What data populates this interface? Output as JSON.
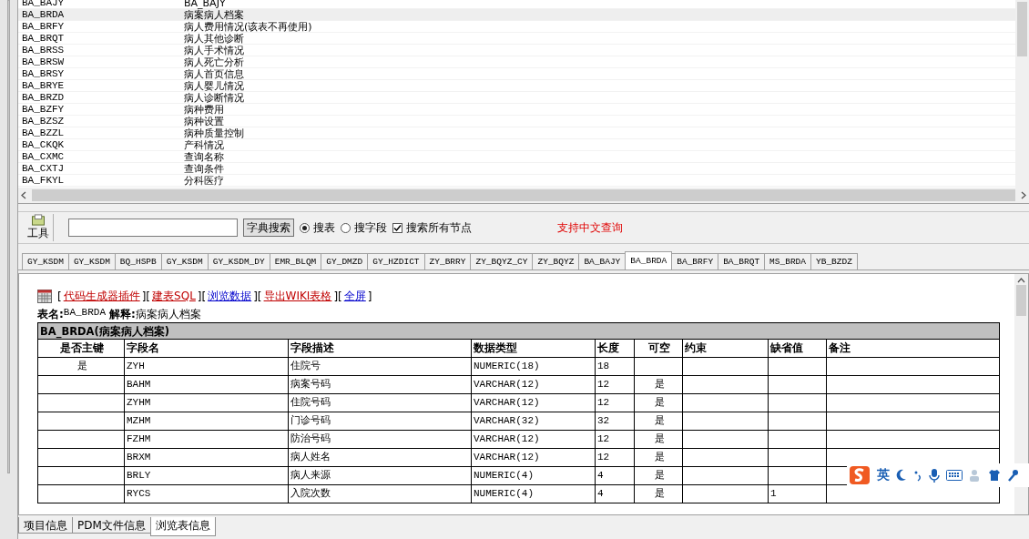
{
  "table_list": {
    "rows": [
      {
        "code": "BA_BAJY",
        "name": "BA_BAJY",
        "selected": false
      },
      {
        "code": "BA_BRDA",
        "name": "病案病人档案",
        "selected": true
      },
      {
        "code": "BA_BRFY",
        "name": "病人费用情况(该表不再使用)",
        "selected": false
      },
      {
        "code": "BA_BRQT",
        "name": "病人其他诊断",
        "selected": false
      },
      {
        "code": "BA_BRSS",
        "name": "病人手术情况",
        "selected": false
      },
      {
        "code": "BA_BRSW",
        "name": "病人死亡分析",
        "selected": false
      },
      {
        "code": "BA_BRSY",
        "name": "病人首页信息",
        "selected": false
      },
      {
        "code": "BA_BRYE",
        "name": "病人婴儿情况",
        "selected": false
      },
      {
        "code": "BA_BRZD",
        "name": "病人诊断情况",
        "selected": false
      },
      {
        "code": "BA_BZFY",
        "name": "病种费用",
        "selected": false
      },
      {
        "code": "BA_BZSZ",
        "name": "病种设置",
        "selected": false
      },
      {
        "code": "BA_BZZL",
        "name": "病种质量控制",
        "selected": false
      },
      {
        "code": "BA_CKQK",
        "name": "产科情况",
        "selected": false
      },
      {
        "code": "BA_CXMC",
        "name": "查询名称",
        "selected": false
      },
      {
        "code": "BA_CXTJ",
        "name": "查询条件",
        "selected": false
      },
      {
        "code": "BA_FKYL",
        "name": "分科医疗",
        "selected": false
      }
    ]
  },
  "toolbar": {
    "tool_button": "工具",
    "search_button": "字典搜索",
    "search_modes": [
      {
        "label": "搜表",
        "selected": true
      },
      {
        "label": "搜字段",
        "selected": false
      }
    ],
    "all_nodes": {
      "label": "搜索所有节点",
      "checked": true
    },
    "hint": "支持中文查询"
  },
  "table_tabs": [
    {
      "label": "GY_KSDM",
      "selected": false
    },
    {
      "label": "GY_KSDM",
      "selected": false
    },
    {
      "label": "BQ_HSPB",
      "selected": false
    },
    {
      "label": "GY_KSDM",
      "selected": false
    },
    {
      "label": "GY_KSDM_DY",
      "selected": false
    },
    {
      "label": "EMR_BLQM",
      "selected": false
    },
    {
      "label": "GY_DMZD",
      "selected": false
    },
    {
      "label": "GY_HZDICT",
      "selected": false
    },
    {
      "label": "ZY_BRRY",
      "selected": false
    },
    {
      "label": "ZY_BQYZ_CY",
      "selected": false
    },
    {
      "label": "ZY_BQYZ",
      "selected": false
    },
    {
      "label": "BA_BAJY",
      "selected": false
    },
    {
      "label": "BA_BRDA",
      "selected": true
    },
    {
      "label": "BA_BRFY",
      "selected": false
    },
    {
      "label": "BA_BRQT",
      "selected": false
    },
    {
      "label": "MS_BRDA",
      "selected": false
    },
    {
      "label": "YB_BZDZ",
      "selected": false
    }
  ],
  "detail": {
    "link_bar": [
      {
        "kind": "punct",
        "text": "["
      },
      {
        "kind": "link",
        "text": "代码生成器插件",
        "color": "#c00000"
      },
      {
        "kind": "punct",
        "text": "]["
      },
      {
        "kind": "link",
        "text": "建表SQL",
        "color": "#c00000"
      },
      {
        "kind": "punct",
        "text": "]["
      },
      {
        "kind": "link",
        "text": "浏览数据",
        "color": "#0000cc"
      },
      {
        "kind": "punct",
        "text": "]["
      },
      {
        "kind": "link",
        "text": "导出WIKI表格",
        "color": "#c00000"
      },
      {
        "kind": "punct",
        "text": "]["
      },
      {
        "kind": "link",
        "text": "全屏",
        "color": "#0000cc"
      },
      {
        "kind": "punct",
        "text": "]"
      }
    ],
    "table_name_label": "表名:",
    "table_name": "BA_BRDA",
    "comment_label": "解释:",
    "comment": "病案病人档案",
    "grid_title": "BA_BRDA(病案病人档案)",
    "columns": [
      "是否主键",
      "字段名",
      "字段描述",
      "数据类型",
      "长度",
      "可空",
      "约束",
      "缺省值",
      "备注"
    ],
    "rows": [
      {
        "primary_key": "是",
        "field": "ZYH",
        "description": "住院号",
        "data_type": "NUMERIC(18)",
        "length": "18"
      },
      {
        "field": "BAHM",
        "description": "病案号码",
        "data_type": "VARCHAR(12)",
        "length": "12",
        "nullable": "是"
      },
      {
        "field": "ZYHM",
        "description": "住院号码",
        "data_type": "VARCHAR(12)",
        "length": "12",
        "nullable": "是"
      },
      {
        "field": "MZHM",
        "description": "门诊号码",
        "data_type": "VARCHAR(32)",
        "length": "32",
        "nullable": "是"
      },
      {
        "field": "FZHM",
        "description": "防治号码",
        "data_type": "VARCHAR(12)",
        "length": "12",
        "nullable": "是"
      },
      {
        "field": "BRXM",
        "description": "病人姓名",
        "data_type": "VARCHAR(12)",
        "length": "12",
        "nullable": "是"
      },
      {
        "field": "BRLY",
        "description": "病人来源",
        "data_type": "NUMERIC(4)",
        "length": "4",
        "nullable": "是"
      },
      {
        "field": "RYCS",
        "description": "入院次数",
        "data_type": "NUMERIC(4)",
        "length": "4",
        "nullable": "是",
        "default": "1"
      }
    ]
  },
  "bottom_tabs": [
    {
      "label": "项目信息",
      "selected": false
    },
    {
      "label": "PDM文件信息",
      "selected": false
    },
    {
      "label": "浏览表信息",
      "selected": true
    }
  ],
  "ime_bar": {
    "mode": "英"
  }
}
